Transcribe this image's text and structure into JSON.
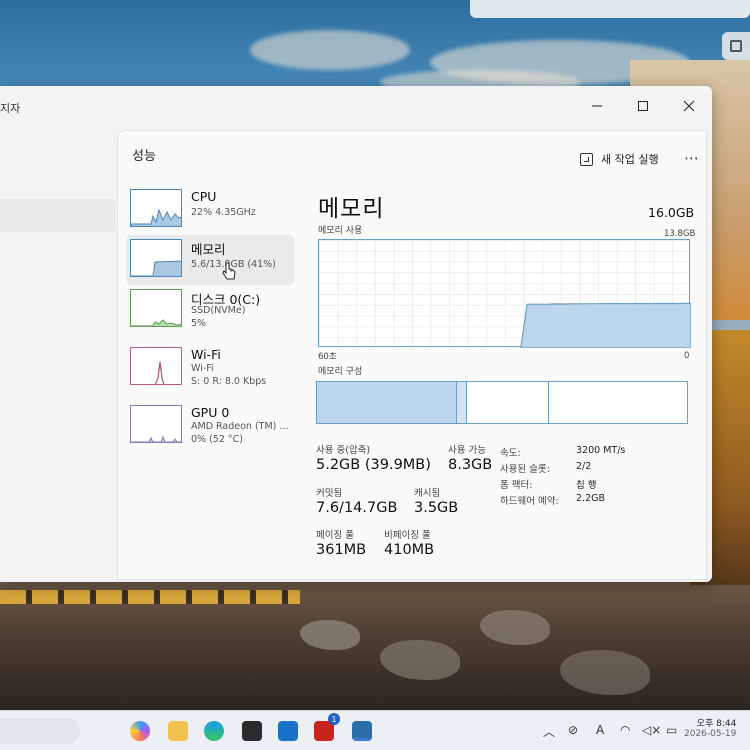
{
  "window": {
    "title_partial": "지자",
    "panel_title": "성능",
    "run_task_label": "새 작업 실행",
    "more_label": "⋯"
  },
  "perf_list": [
    {
      "name": "CPU",
      "sub1": "22% 4.35GHz",
      "sub2": ""
    },
    {
      "name": "메모리",
      "sub1": "5.6/13.8GB (41%)",
      "sub2": ""
    },
    {
      "name": "디스크 0(C:)",
      "sub1": "SSD(NVMe)",
      "sub2": "5%"
    },
    {
      "name": "Wi-Fi",
      "sub1": "Wi-Fi",
      "sub2": "S: 0 R: 8.0 Kbps"
    },
    {
      "name": "GPU 0",
      "sub1": "AMD Radeon (TM) ...",
      "sub2": "0% (52 °C)"
    }
  ],
  "memory": {
    "title": "메모리",
    "total": "16.0GB",
    "usage_label": "메모리 사용",
    "usage_max": "13.8GB",
    "axis_left": "60초",
    "axis_right": "0",
    "composition_label": "메모리 구성",
    "usage_history": [
      0,
      0,
      0,
      0,
      0,
      0,
      0,
      0,
      0,
      0,
      0,
      0,
      0,
      0,
      0,
      0,
      0,
      0,
      0,
      0,
      0,
      0,
      0,
      0,
      0,
      0,
      0,
      0,
      0,
      0,
      0,
      0,
      0,
      40.5,
      40.6,
      40.6,
      40.5,
      40.7,
      40.8,
      40.7,
      40.8,
      40.9,
      40.9,
      41.0,
      41.0,
      41.0,
      41.1,
      41.1,
      41.1,
      41.0,
      41.2,
      41.2,
      41.1,
      41.2,
      41.2,
      41.3,
      41.2,
      41.2,
      41.3,
      41.3
    ]
  },
  "stats": {
    "in_use_label": "사용 중(압축)",
    "in_use_value": "5.2GB (39.9MB)",
    "available_label": "사용 가능",
    "available_value": "8.3GB",
    "committed_label": "커밋됨",
    "committed_value": "7.6/14.7GB",
    "cached_label": "캐시됨",
    "cached_value": "3.5GB",
    "paged_label": "페이징 풀",
    "paged_value": "361MB",
    "nonpaged_label": "비페이징 풀",
    "nonpaged_value": "410MB"
  },
  "details": [
    {
      "key": "속도:",
      "value": "3200 MT/s"
    },
    {
      "key": "사용된 슬롯:",
      "value": "2/2"
    },
    {
      "key": "폼 팩터:",
      "value": "칩 행"
    },
    {
      "key": "하드웨어 예약:",
      "value": "2.2GB"
    }
  ],
  "taskbar": {
    "badge": "1",
    "time": "오후 8:44",
    "date": "2026-05-19",
    "tray_a": "A"
  },
  "colors": {
    "accent": "#6a9fc6",
    "fill": "#bcd5ea",
    "window_bg": "#f3f3f3"
  }
}
